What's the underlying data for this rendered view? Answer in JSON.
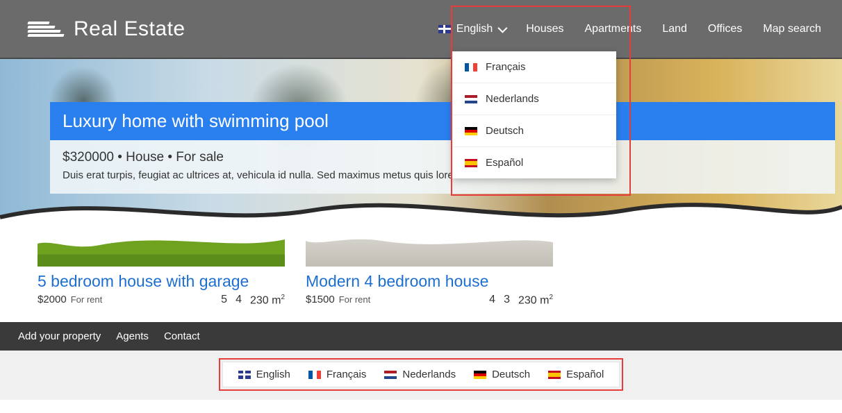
{
  "logo": {
    "text": "Real Estate"
  },
  "nav": {
    "houses": "Houses",
    "apartments": "Apartments",
    "land": "Land",
    "offices": "Offices",
    "map_search": "Map search"
  },
  "language": {
    "current": "English",
    "options": [
      {
        "label": "Français",
        "flag": "fr"
      },
      {
        "label": "Nederlands",
        "flag": "nl"
      },
      {
        "label": "Deutsch",
        "flag": "de"
      },
      {
        "label": "Español",
        "flag": "es"
      }
    ]
  },
  "hero": {
    "title": "Luxury home with swimming pool",
    "meta": "$320000 • House • For sale",
    "desc": "Duis erat turpis, feugiat ac ultrices at, vehicula id nulla. Sed maximus metus quis loren"
  },
  "listings": [
    {
      "title": "5 bedroom house with garage",
      "price": "$2000",
      "status": "For rent",
      "beds": "5",
      "baths": "4",
      "area": "230 m",
      "thumb": "grass"
    },
    {
      "title": "Modern 4 bedroom house",
      "price": "$1500",
      "status": "For rent",
      "beds": "4",
      "baths": "3",
      "area": "230 m",
      "thumb": "stone"
    }
  ],
  "footer_dark": {
    "add": "Add your property",
    "agents": "Agents",
    "contact": "Contact"
  },
  "footer_langs": [
    {
      "label": "English",
      "flag": "gb"
    },
    {
      "label": "Français",
      "flag": "fr"
    },
    {
      "label": "Nederlands",
      "flag": "nl"
    },
    {
      "label": "Deutsch",
      "flag": "de"
    },
    {
      "label": "Español",
      "flag": "es"
    }
  ]
}
